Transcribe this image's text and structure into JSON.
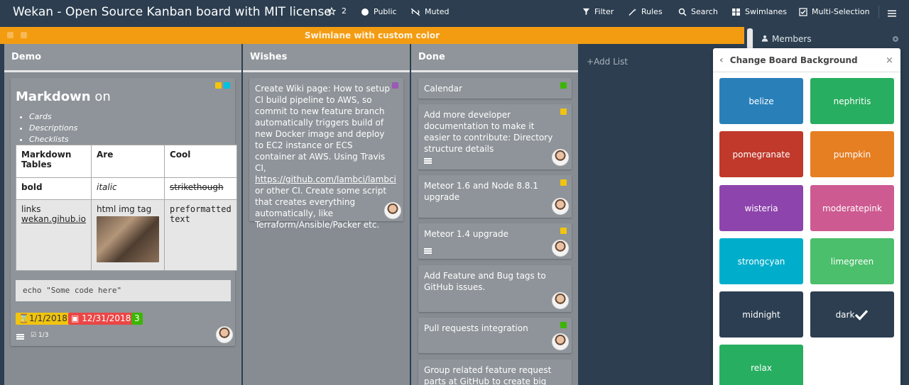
{
  "header": {
    "title": "Wekan - Open Source Kanban board with MIT license",
    "star_count": "2",
    "visibility": "Public",
    "watch": "Muted",
    "filter": "Filter",
    "rules": "Rules",
    "search": "Search",
    "swimlanes": "Swimlanes",
    "multi_selection": "Multi-Selection"
  },
  "swimlane": {
    "title": "Swimlane with custom color",
    "color": "#f39c12"
  },
  "lists": {
    "demo": {
      "title": "Demo",
      "markdown_card": {
        "heading_bold": "Markdown",
        "heading_rest": "on",
        "bullets": [
          "Cards",
          "Descriptions",
          "Checklists"
        ],
        "table": {
          "headers": [
            "Markdown Tables",
            "Are",
            "Cool"
          ],
          "row1": [
            "bold",
            "italic",
            "strikethough"
          ],
          "row2": [
            "links",
            "html img tag",
            "preformatted text"
          ],
          "link_text": "wekan.gihub.io"
        },
        "code": "echo \"Some code here\"",
        "start_date": "1/1/2018",
        "due_date": "12/31/2018",
        "badge_count": "3",
        "checklist": "1/3",
        "label_colors": [
          "#f1c40f",
          "#00c2e0"
        ]
      }
    },
    "wishes": {
      "title": "Wishes",
      "card": {
        "text": "Create Wiki page: How to setup CI build pipeline to AWS, so commit to new feature branch automatically triggers build of new Docker image and deploy to EC2 instance or ECS container at AWS. Using Travis CI,",
        "link": "https://github.com/lambci/lambci",
        "text_after": "or other CI. Create some script that creates everything automatically, like Terraform/Ansible/Packer etc.",
        "label_color": "#9b59b6"
      }
    },
    "done": {
      "title": "Done",
      "cards": [
        {
          "title": "Calendar",
          "label_color": "#51e898"
        },
        {
          "title": "Add more developer documentation to make it easier to contribute: Directory structure details",
          "label_color": "#f1c40f"
        },
        {
          "title": "Meteor 1.6 and Node 8.8.1 upgrade",
          "label_color": "#f1c40f"
        },
        {
          "title": "Meteor 1.4 upgrade",
          "label_color": "#f1c40f"
        },
        {
          "title": "Add Feature and Bug tags to GitHub issues.",
          "label_color": ""
        },
        {
          "title": "Pull requests integration",
          "label_color": "#3cb500"
        },
        {
          "title": "Group related feature request parts at GitHub to create big picture, and",
          "label_color": ""
        }
      ]
    },
    "add_list": "Add List"
  },
  "sidebar": {
    "members_title": "Members"
  },
  "popup": {
    "title": "Change Board Background",
    "swatches": [
      {
        "name": "belize",
        "color": "#2980b9"
      },
      {
        "name": "nephritis",
        "color": "#27ae60"
      },
      {
        "name": "pomegranate",
        "color": "#c0392b"
      },
      {
        "name": "pumpkin",
        "color": "#e67e22"
      },
      {
        "name": "wisteria",
        "color": "#8e44ad"
      },
      {
        "name": "moderatepink",
        "color": "#cd5a91"
      },
      {
        "name": "strongcyan",
        "color": "#00aecc"
      },
      {
        "name": "limegreen",
        "color": "#4bbf6b"
      },
      {
        "name": "midnight",
        "color": "#2c3e51"
      },
      {
        "name": "dark",
        "color": "#2c3e50"
      },
      {
        "name": "relax",
        "color": "#27ae61"
      }
    ],
    "selected": "dark"
  }
}
